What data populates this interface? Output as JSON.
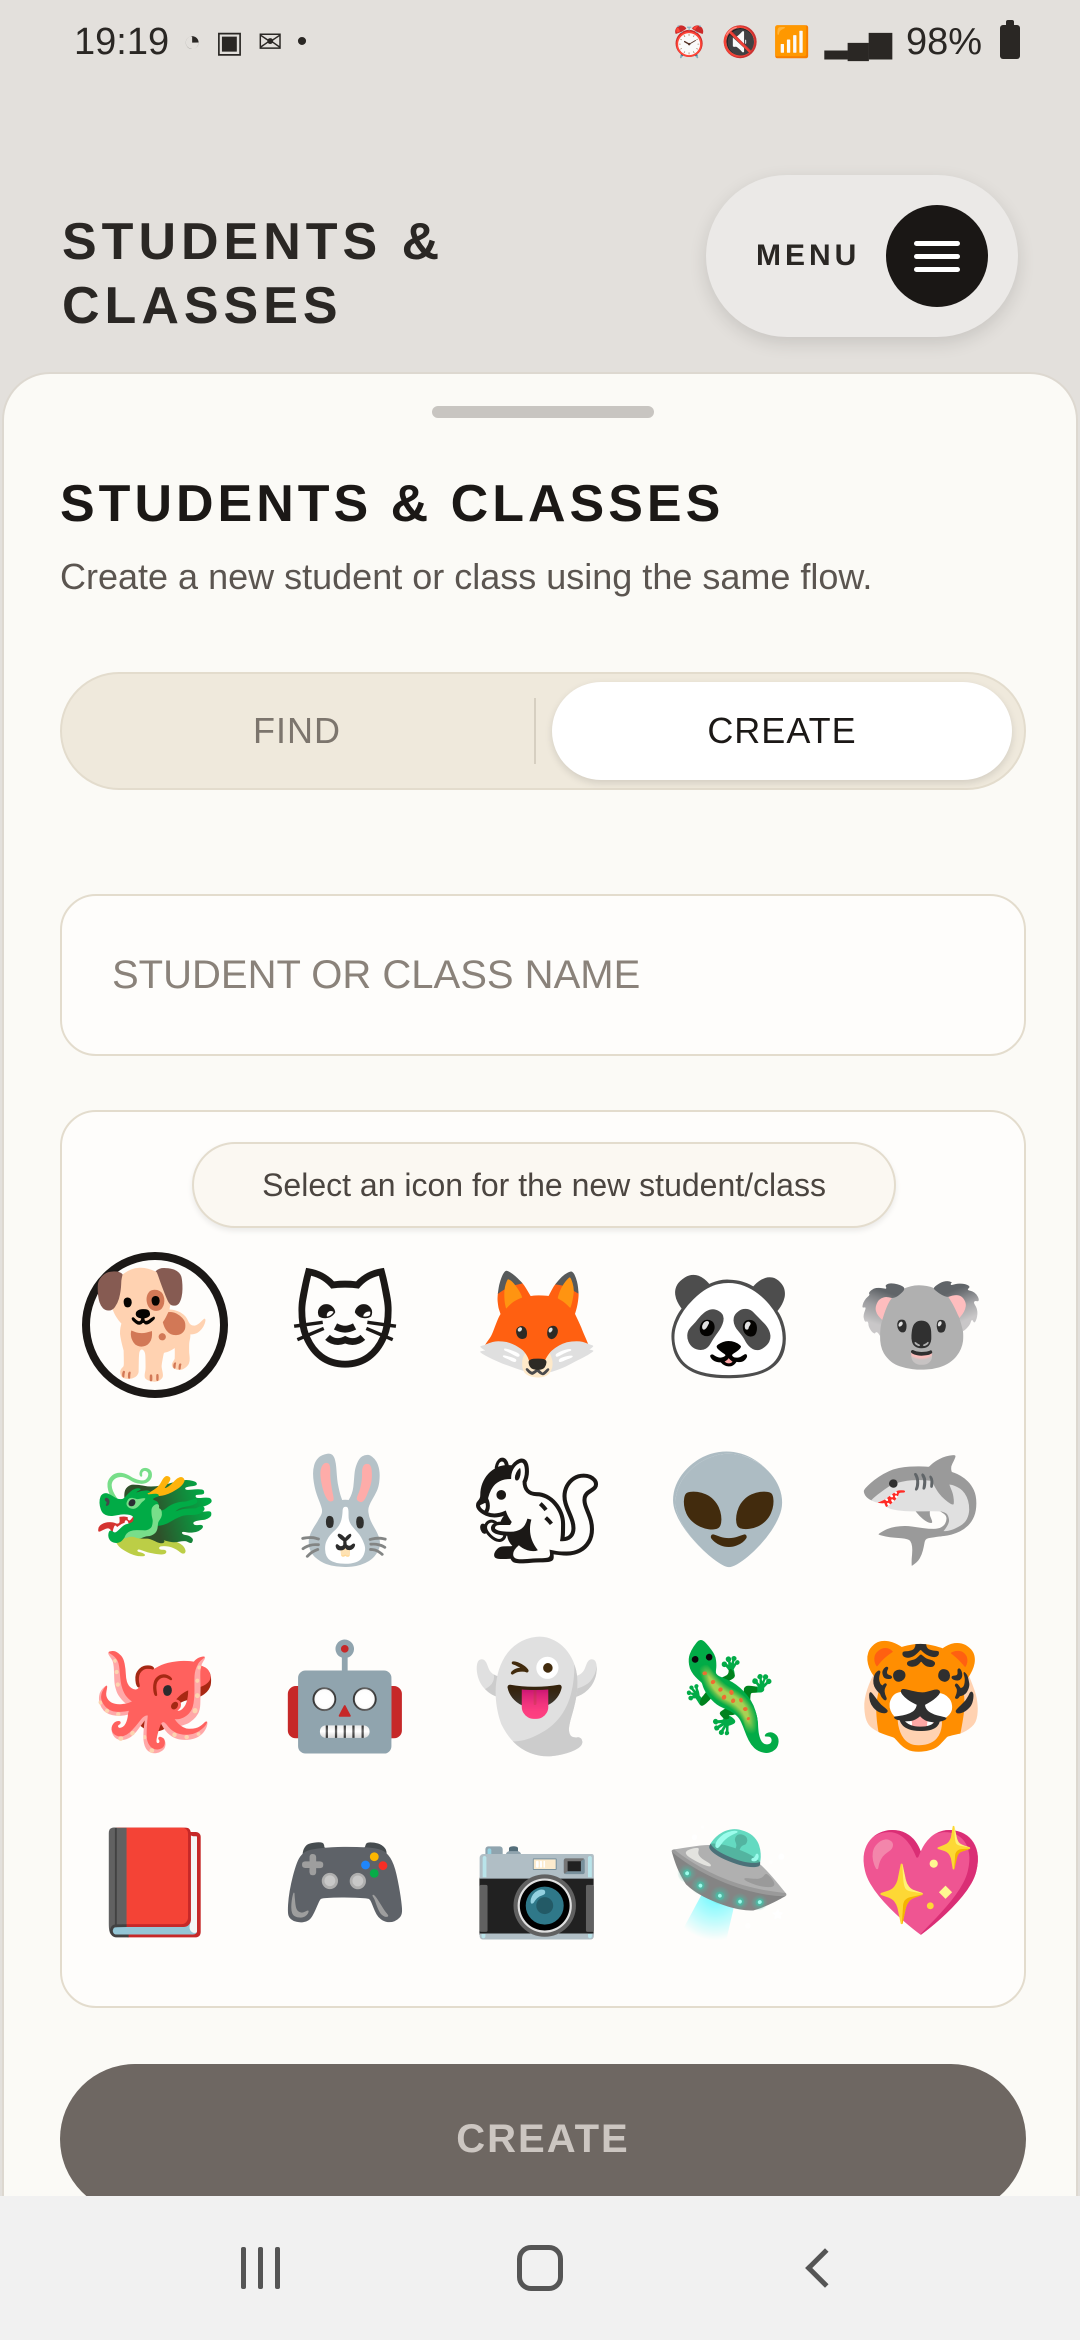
{
  "status_bar": {
    "time": "19:19",
    "left_icons": [
      "data-saver-icon",
      "gallery-icon",
      "gmail-icon",
      "dot-icon"
    ],
    "right_icons": [
      "alarm-icon",
      "mute-icon",
      "wifi-icon",
      "signal-icon",
      "signal-icon"
    ],
    "battery": "98%"
  },
  "header": {
    "title": "STUDENTS & CLASSES",
    "menu_label": "MENU"
  },
  "sheet": {
    "title": "STUDENTS & CLASSES",
    "subtitle": "Create a new student or class using the same flow.",
    "tabs": {
      "find": "FIND",
      "create": "CREATE",
      "active": "CREATE"
    },
    "name_input": {
      "placeholder": "STUDENT OR CLASS NAME",
      "value": ""
    },
    "icon_picker": {
      "hint": "Select an icon for the new student/class",
      "selected_index": 0,
      "icons": [
        {
          "name": "aviator-dog",
          "glyph": "🐕"
        },
        {
          "name": "orange-cat",
          "glyph": "🐱"
        },
        {
          "name": "fox",
          "glyph": "🦊"
        },
        {
          "name": "cyber-panda",
          "glyph": "🐼"
        },
        {
          "name": "koala",
          "glyph": "🐨"
        },
        {
          "name": "dragon",
          "glyph": "🐲"
        },
        {
          "name": "hunter-rabbit",
          "glyph": "🐰"
        },
        {
          "name": "wizard-squirrel",
          "glyph": "🐿"
        },
        {
          "name": "alien-ufo",
          "glyph": "👽"
        },
        {
          "name": "wizard-shark",
          "glyph": "🦈"
        },
        {
          "name": "steampunk-octopus",
          "glyph": "🐙"
        },
        {
          "name": "robot",
          "glyph": "🤖"
        },
        {
          "name": "ghost-wizard",
          "glyph": "👻"
        },
        {
          "name": "axolotl",
          "glyph": "🦎"
        },
        {
          "name": "tiger",
          "glyph": "🐯"
        },
        {
          "name": "eye-book",
          "glyph": "📕"
        },
        {
          "name": "game-console",
          "glyph": "🎮"
        },
        {
          "name": "camera-robot",
          "glyph": "📷"
        },
        {
          "name": "ufo-cow",
          "glyph": "🛸"
        },
        {
          "name": "heart-gem",
          "glyph": "💖"
        }
      ]
    },
    "create_button": "CREATE"
  },
  "colors": {
    "background": "#e3e0dc",
    "sheet": "#fbfaf6",
    "accent_dark": "#1b1816",
    "button_disabled": "#6e6762"
  }
}
